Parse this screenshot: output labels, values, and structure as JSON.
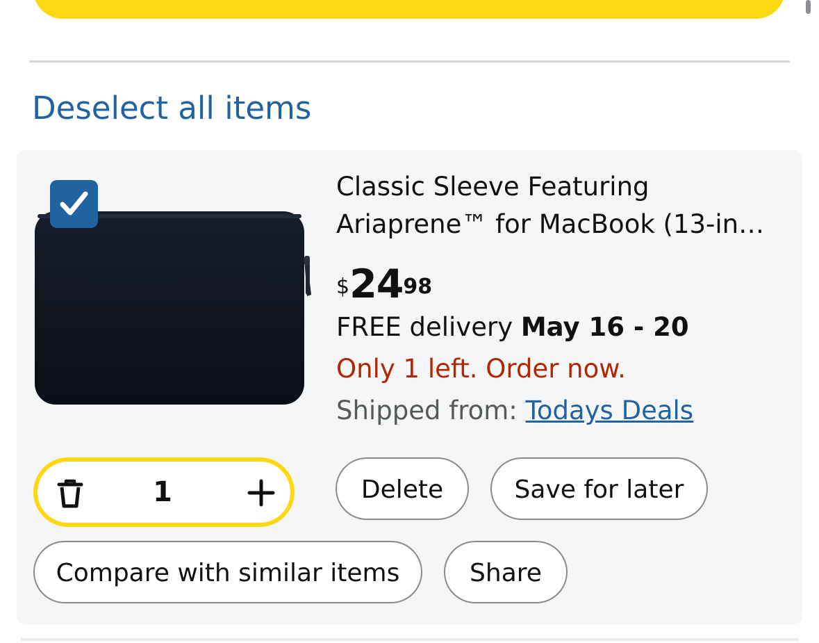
{
  "header": {
    "deselect_label": "Deselect all items"
  },
  "item": {
    "title_line1": "Classic Sleeve Featuring",
    "title_line2": "Ariaprene™ for MacBook (13-in…",
    "price_symbol": "$",
    "price_whole": "24",
    "price_fraction": "98",
    "delivery_prefix": "FREE delivery ",
    "delivery_dates": "May 16 - 20",
    "stock_message": "Only 1 left. Order now.",
    "shipped_label": "Shipped from: ",
    "shipped_seller": "Todays Deals",
    "quantity": "1",
    "selected": true
  },
  "actions": {
    "delete_label": "Delete",
    "save_label": "Save for later",
    "compare_label": "Compare with similar items",
    "share_label": "Share"
  },
  "colors": {
    "accent_yellow": "#ffd814",
    "link_blue": "#2162a1",
    "stock_red": "#b12704",
    "card_bg": "#f5f6f7"
  },
  "icons": {
    "checkbox": "checkmark-icon",
    "trash": "trash-icon",
    "plus": "plus-icon"
  }
}
